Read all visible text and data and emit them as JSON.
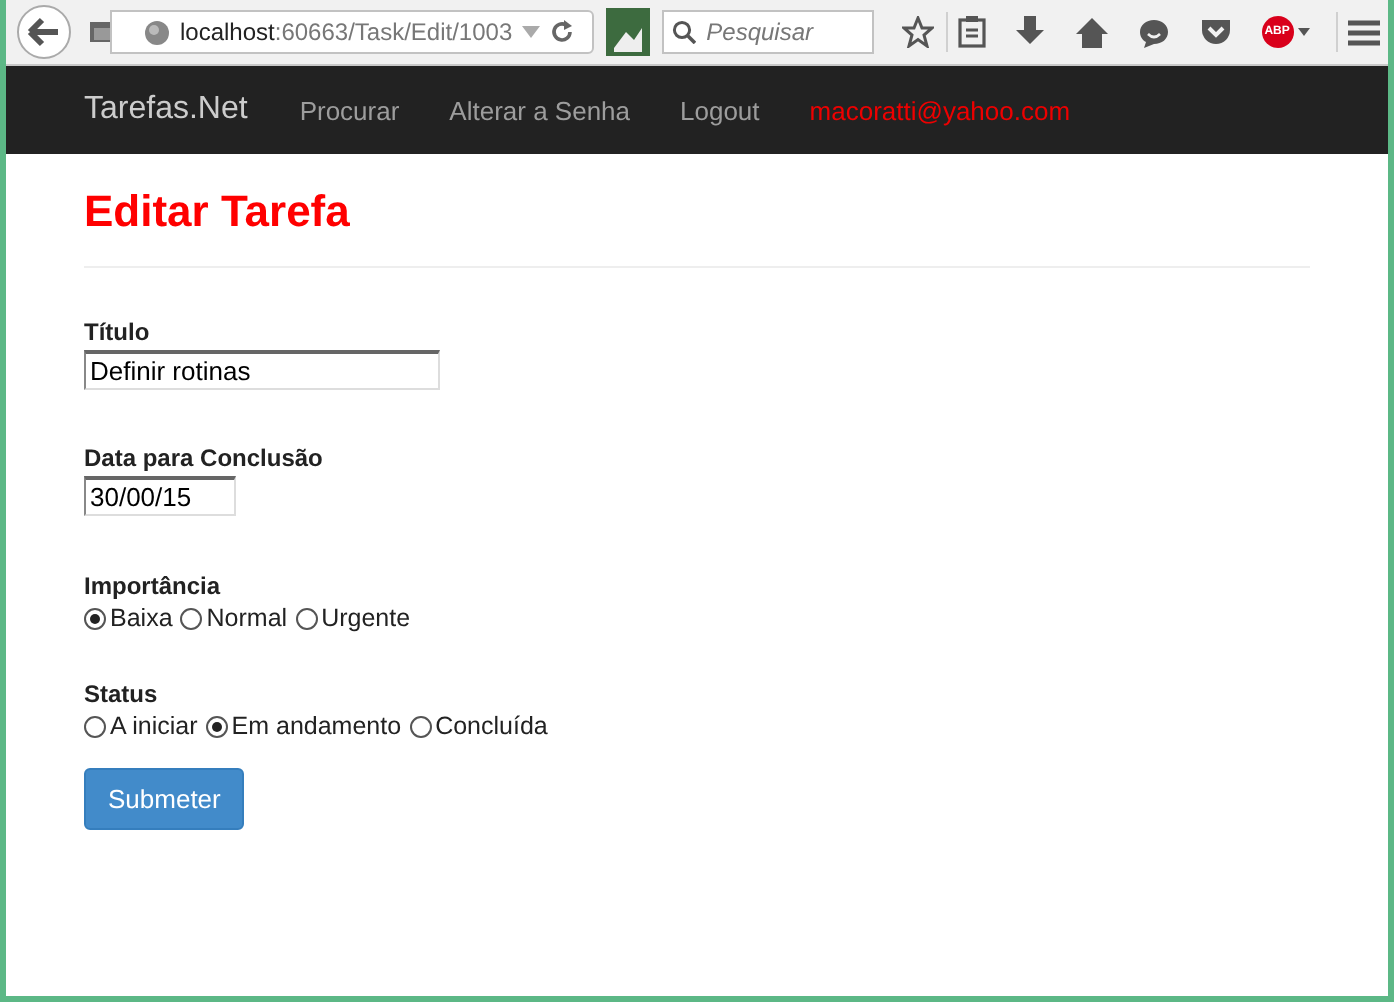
{
  "browser": {
    "url_host": "localhost",
    "url_path": ":60663/Task/Edit/1003",
    "search_placeholder": "Pesquisar",
    "adblock_label": "ABP"
  },
  "navbar": {
    "brand": "Tarefas.Net",
    "links": [
      {
        "label": "Procurar",
        "kind": "link"
      },
      {
        "label": "Alterar a Senha",
        "kind": "link"
      },
      {
        "label": "Logout",
        "kind": "link"
      },
      {
        "label": "macoratti@yahoo.com",
        "kind": "user"
      }
    ]
  },
  "heading": "Editar Tarefa",
  "fields": [
    {
      "label": "Título",
      "value": "Definir rotinas",
      "kind": "text"
    },
    {
      "label": "Data para Conclusão",
      "value": "30/00/15",
      "kind": "date"
    }
  ],
  "radio_groups": [
    {
      "label": "Importância",
      "options": [
        {
          "label": "Baixa",
          "selected": true
        },
        {
          "label": "Normal",
          "selected": false
        },
        {
          "label": "Urgente",
          "selected": false
        }
      ]
    },
    {
      "label": "Status",
      "options": [
        {
          "label": "A iniciar",
          "selected": false
        },
        {
          "label": "Em andamento",
          "selected": true
        },
        {
          "label": "Concluída",
          "selected": false
        }
      ]
    }
  ],
  "submit": "Submeter"
}
